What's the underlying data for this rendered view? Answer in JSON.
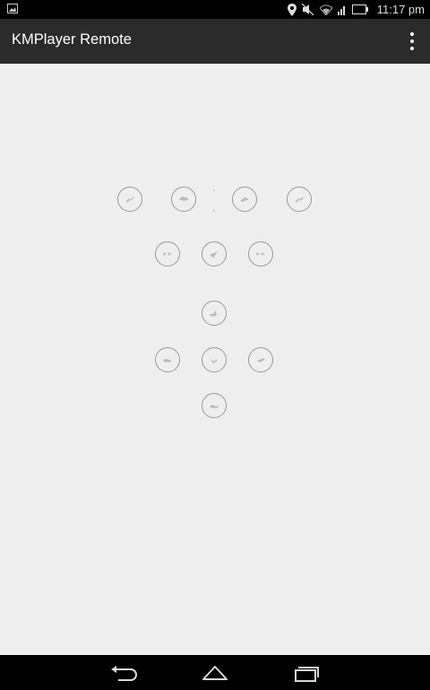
{
  "status_bar": {
    "time": "11:17 pm",
    "icons": [
      "image-notification-icon",
      "location-icon",
      "mute-icon",
      "wifi-icon",
      "signal-icon",
      "battery-icon"
    ]
  },
  "app": {
    "title": "KMPlayer Remote",
    "accent_bg": "#2b2b2b",
    "content_bg": "#eeeeee"
  },
  "remote_buttons": [
    {
      "name": "rewind-fast-button",
      "icon": "rewind-fast-icon"
    },
    {
      "name": "rewind-button",
      "icon": "rewind-icon"
    },
    {
      "name": "forward-button",
      "icon": "forward-icon"
    },
    {
      "name": "forward-fast-button",
      "icon": "forward-fast-icon"
    },
    {
      "name": "previous-button",
      "icon": "previous-icon"
    },
    {
      "name": "play-button",
      "icon": "play-icon"
    },
    {
      "name": "next-button",
      "icon": "next-icon"
    },
    {
      "name": "volume-up-button",
      "icon": "volume-up-icon"
    },
    {
      "name": "volume-down-button",
      "icon": "volume-down-icon"
    },
    {
      "name": "stop-button",
      "icon": "stop-icon"
    },
    {
      "name": "mute-button",
      "icon": "mute-icon"
    },
    {
      "name": "fullscreen-button",
      "icon": "fullscreen-icon"
    }
  ],
  "nav_bar": {
    "buttons": [
      "back-icon",
      "home-icon",
      "recents-icon"
    ]
  }
}
